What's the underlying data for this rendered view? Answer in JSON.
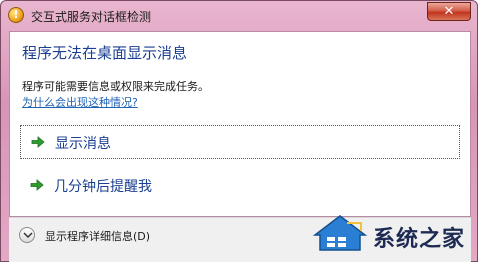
{
  "window": {
    "title": "交互式服务对话框检测",
    "close_glyph": "✕",
    "app_icon_glyph": "!"
  },
  "main": {
    "heading": "程序无法在桌面显示消息",
    "description": "程序可能需要信息或权限来完成任务。",
    "help_link": "为什么会出现这种情况?"
  },
  "options": [
    {
      "label": "显示消息",
      "icon": "green-arrow-icon"
    },
    {
      "label": "几分钟后提醒我",
      "icon": "green-arrow-icon"
    }
  ],
  "footer": {
    "details_label": "显示程序详细信息(D)",
    "icon": "chevron-down-icon"
  },
  "watermark": {
    "text": "系统之家"
  },
  "colors": {
    "heading": "#1b3f91",
    "link": "#1f63b6",
    "arrow": "#2e9b2e",
    "titlebar": "#d895b6"
  }
}
